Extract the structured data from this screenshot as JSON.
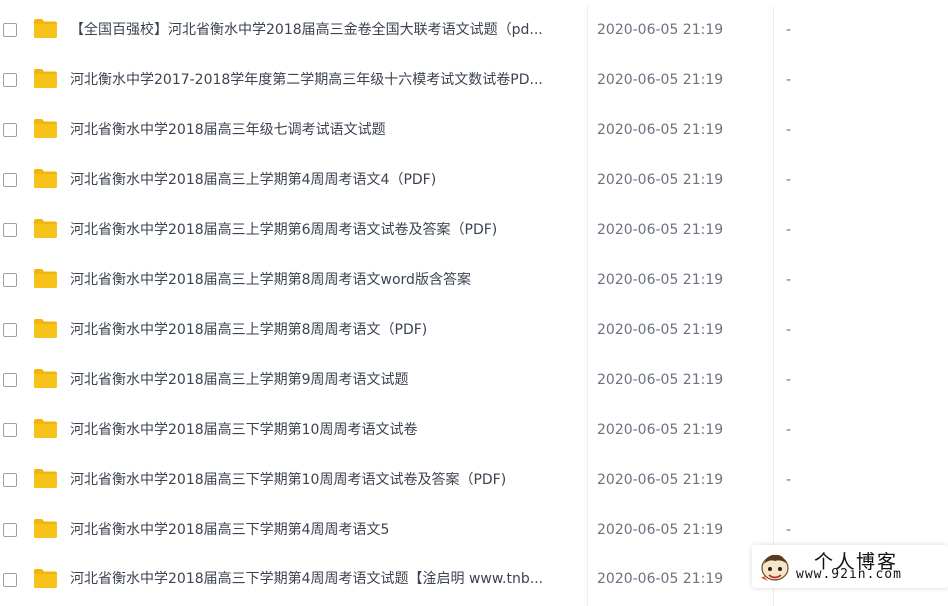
{
  "files": [
    {
      "name": "【全国百强校】河北省衡水中学2018届高三金卷全国大联考语文试题（pd...",
      "modified": "2020-06-05 21:19",
      "size": "-"
    },
    {
      "name": "河北衡水中学2017-2018学年度第二学期高三年级十六模考试文数试卷PD...",
      "modified": "2020-06-05 21:19",
      "size": "-"
    },
    {
      "name": "河北省衡水中学2018届高三年级七调考试语文试题",
      "modified": "2020-06-05 21:19",
      "size": "-"
    },
    {
      "name": "河北省衡水中学2018届高三上学期第4周周考语文4（PDF)",
      "modified": "2020-06-05 21:19",
      "size": "-"
    },
    {
      "name": "河北省衡水中学2018届高三上学期第6周周考语文试卷及答案（PDF)",
      "modified": "2020-06-05 21:19",
      "size": "-"
    },
    {
      "name": "河北省衡水中学2018届高三上学期第8周周考语文word版含答案",
      "modified": "2020-06-05 21:19",
      "size": "-"
    },
    {
      "name": "河北省衡水中学2018届高三上学期第8周周考语文（PDF)",
      "modified": "2020-06-05 21:19",
      "size": "-"
    },
    {
      "name": "河北省衡水中学2018届高三上学期第9周周考语文试题",
      "modified": "2020-06-05 21:19",
      "size": "-"
    },
    {
      "name": "河北省衡水中学2018届高三下学期第10周周考语文试卷",
      "modified": "2020-06-05 21:19",
      "size": "-"
    },
    {
      "name": "河北省衡水中学2018届高三下学期第10周周考语文试卷及答案（PDF)",
      "modified": "2020-06-05 21:19",
      "size": "-"
    },
    {
      "name": "河北省衡水中学2018届高三下学期第4周周考语文5",
      "modified": "2020-06-05 21:19",
      "size": "-"
    },
    {
      "name": "河北省衡水中学2018届高三下学期第4周周考语文试题【淦启明 www.tnb...",
      "modified": "2020-06-05 21:19",
      "size": "-"
    }
  ],
  "watermark": {
    "title": "个人博客",
    "url": "www.92in.com"
  },
  "colors": {
    "folder": "#f7c21a",
    "folder_tab": "#f0b40d"
  }
}
